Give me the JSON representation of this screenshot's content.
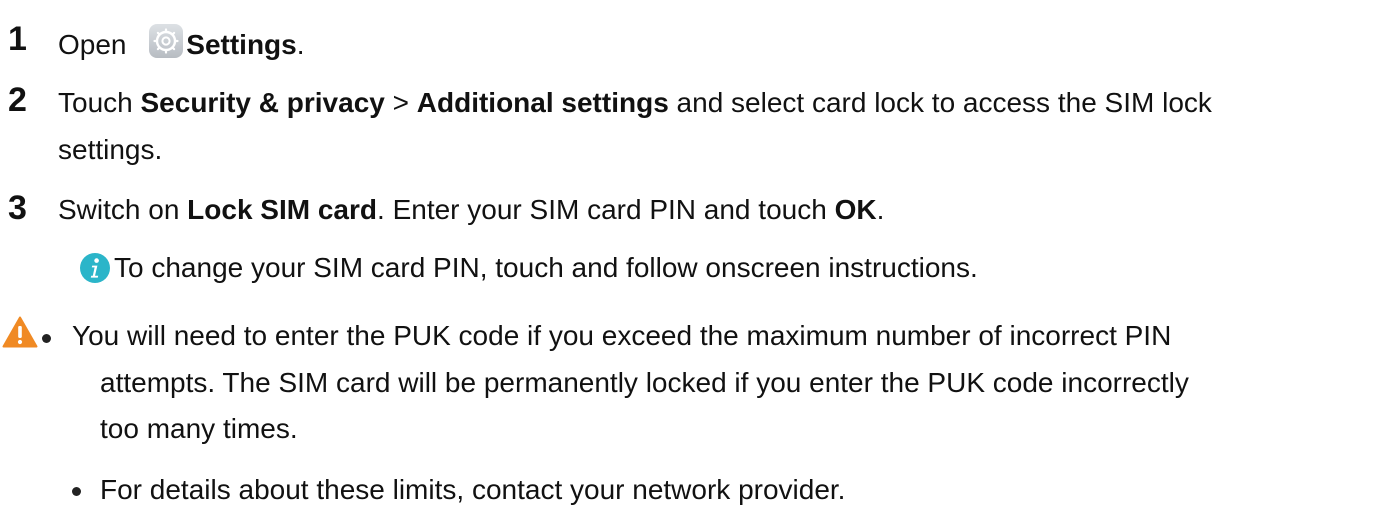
{
  "colors": {
    "text": "#111111",
    "info_icon": "#2bb5c9",
    "warning_icon": "#f08a24",
    "settings_icon_bg": "#c7ccd1"
  },
  "steps": [
    {
      "number": "1",
      "pre": "Open ",
      "icon": "settings-gear-icon",
      "bold1": "Settings",
      "post": "."
    },
    {
      "number": "2",
      "pre": "Touch ",
      "bold1": "Security & privacy",
      "mid": " > ",
      "bold2": "Additional settings",
      "post_line1": " and select card lock to access the SIM lock",
      "line2": "settings."
    },
    {
      "number": "3",
      "pre": "Switch on ",
      "bold1": "Lock SIM card",
      "mid": ". Enter your SIM card PIN and touch ",
      "bold2": "OK",
      "post": "."
    }
  ],
  "note": {
    "icon": "info-icon",
    "text": "To change your SIM card PIN, touch and follow onscreen instructions."
  },
  "warning": {
    "icon": "warning-icon",
    "bullets": [
      {
        "lines": [
          "You will need to enter the PUK code if you exceed the maximum number of incorrect PIN",
          "attempts. The SIM card will be permanently locked if you enter the PUK code incorrectly",
          "too many times."
        ]
      },
      {
        "lines": [
          "For details about these limits, contact your network provider."
        ]
      }
    ]
  }
}
